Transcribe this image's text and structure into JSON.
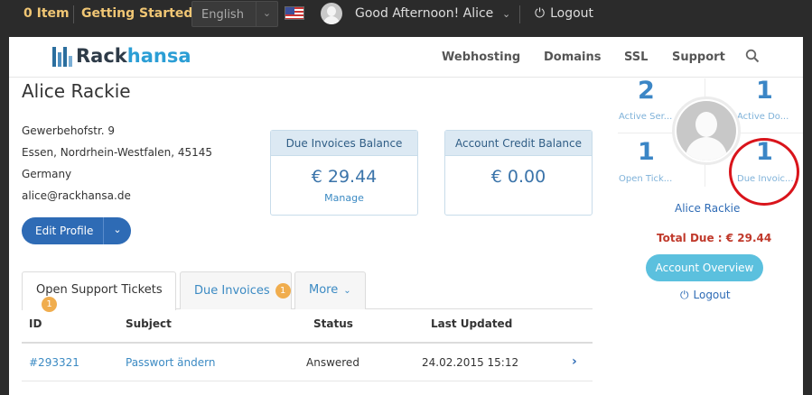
{
  "topbar": {
    "cart_label": "0 Item",
    "getting_started": "Getting Started",
    "language_selected": "English",
    "flag_icon": "us-flag-icon",
    "greeting": "Good Afternoon! Alice",
    "logout": "Logout"
  },
  "navbar": {
    "logo_part1": "Rack",
    "logo_part2": "hansa",
    "items": [
      "Webhosting",
      "Domains",
      "SSL",
      "Support"
    ],
    "search_icon": "search-icon"
  },
  "client": {
    "name": "Alice Rackie",
    "address_lines": [
      "Gewerbehofstr. 9",
      "Essen, Nordrhein-Westfalen, 45145",
      "Germany",
      "alice@rackhansa.de"
    ],
    "edit_profile": "Edit Profile"
  },
  "stats": {
    "due_invoices": {
      "title": "Due Invoices Balance",
      "value": "€ 29.44",
      "link": "Manage"
    },
    "credit": {
      "title": "Account Credit Balance",
      "value": "€ 0.00"
    }
  },
  "tabs": [
    {
      "label": "Open Support Tickets",
      "badge": "1"
    },
    {
      "label": "Due Invoices",
      "badge": "1"
    },
    {
      "label": "More"
    }
  ],
  "table": {
    "headers": [
      "ID",
      "Subject",
      "Status",
      "Last Updated"
    ],
    "rows": [
      {
        "id": "#293321",
        "subject": "Passwort ändern",
        "status": "Answered",
        "updated": "24.02.2015 15:12"
      }
    ]
  },
  "sidebar": {
    "active_services": {
      "count": "2",
      "label": "Active Ser..."
    },
    "active_domains": {
      "count": "1",
      "label": "Active Do..."
    },
    "open_tickets": {
      "count": "1",
      "label": "Open Tick..."
    },
    "due_invoices": {
      "count": "1",
      "label": "Due Invoic..."
    },
    "name": "Alice Rackie",
    "total_due": "Total Due : € 29.44",
    "account_overview": "Account Overview",
    "logout": "Logout"
  },
  "colors": {
    "accent_blue": "#3b86c6",
    "button_blue": "#2e6bb5",
    "overview_button": "#5bc0de",
    "badge_orange": "#f0ad4e",
    "due_red": "#c0392b",
    "annotation_red": "#d9141b"
  }
}
